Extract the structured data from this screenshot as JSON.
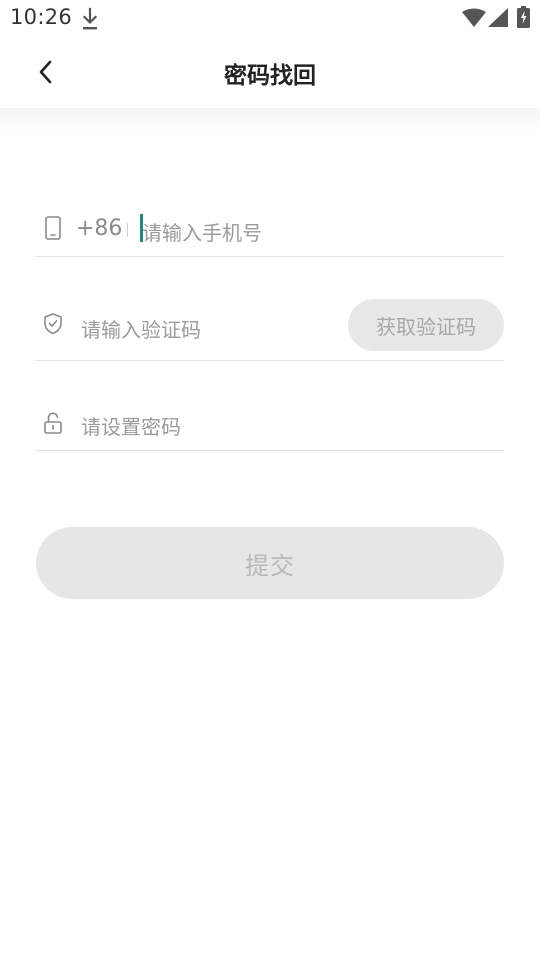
{
  "status_bar": {
    "time": "10:26",
    "icons": [
      "download-icon",
      "wifi-icon",
      "signal-icon",
      "battery-icon"
    ]
  },
  "header": {
    "back_icon": "chevron-left-icon",
    "title": "密码找回"
  },
  "form": {
    "phone": {
      "icon": "mobile-phone-icon",
      "country_code": "+86",
      "placeholder": "请输入手机号",
      "value": ""
    },
    "verification_code": {
      "icon": "shield-check-icon",
      "placeholder": "请输入验证码",
      "value": "",
      "get_code_label": "获取验证码"
    },
    "password": {
      "icon": "lock-icon",
      "placeholder": "请设置密码",
      "value": ""
    },
    "submit_label": "提交"
  },
  "colors": {
    "cursor": "#1a8a82",
    "button_disabled_bg": "#e6e6e6",
    "button_disabled_text": "#b8b8b8",
    "placeholder_text": "#9b9b9b"
  }
}
